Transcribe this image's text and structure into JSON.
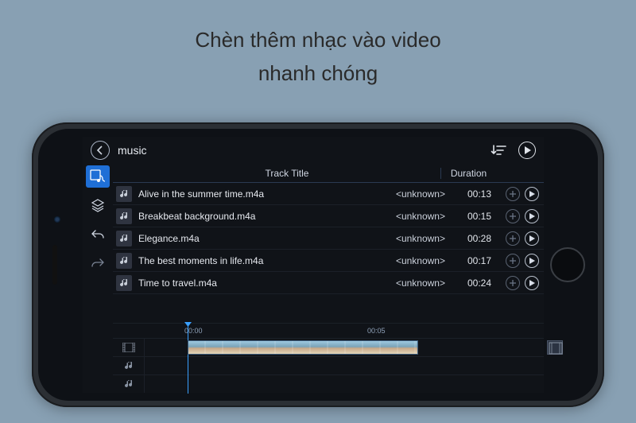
{
  "promo": {
    "line1": "Chèn thêm nhạc vào video",
    "line2": "nhanh chóng"
  },
  "screen": {
    "title": "music",
    "columns": {
      "title": "Track Title",
      "duration": "Duration"
    },
    "tracks": [
      {
        "name": "Alive in the summer time.m4a",
        "artist": "<unknown>",
        "duration": "00:13"
      },
      {
        "name": "Breakbeat background.m4a",
        "artist": "<unknown>",
        "duration": "00:15"
      },
      {
        "name": "Elegance.m4a",
        "artist": "<unknown>",
        "duration": "00:28"
      },
      {
        "name": "The best moments in life.m4a",
        "artist": "<unknown>",
        "duration": "00:17"
      },
      {
        "name": "Time to travel.m4a",
        "artist": "<unknown>",
        "duration": "00:24"
      }
    ],
    "timeline": {
      "t0": "00:00",
      "t1": "00:05"
    }
  }
}
